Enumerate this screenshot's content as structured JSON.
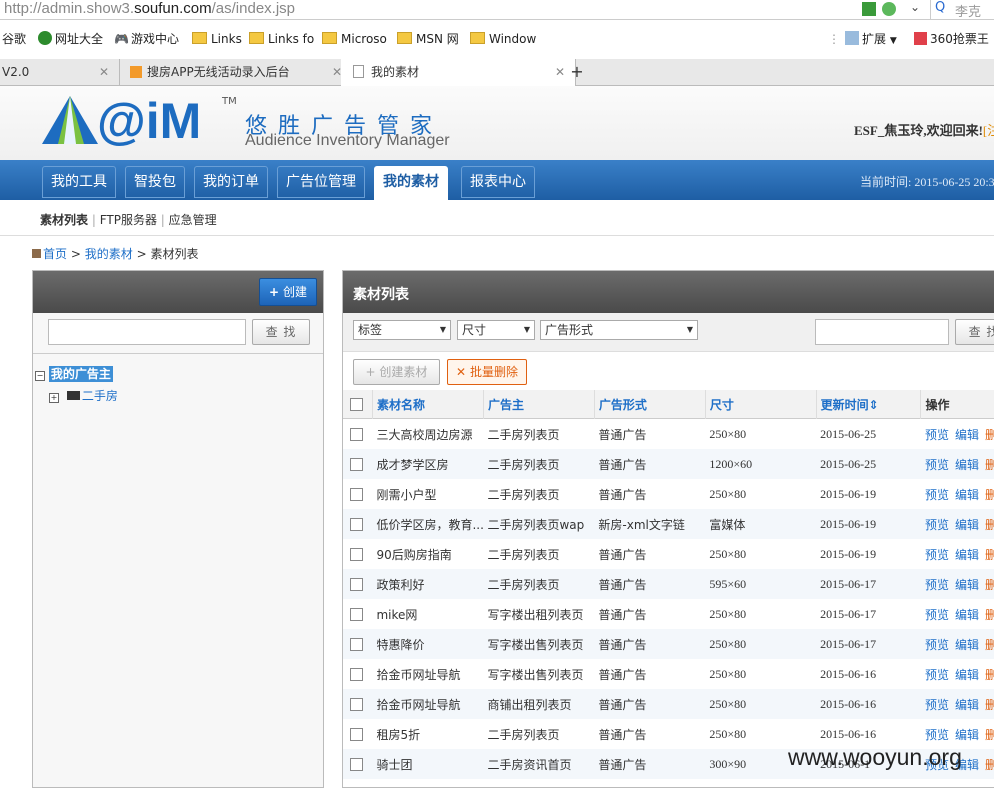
{
  "browser": {
    "url_prefix": "http://admin.show3.",
    "url_domain": "soufun.com",
    "url_suffix": "/as/index.jsp",
    "search_placeholder": "李克",
    "bookmarks": [
      "谷歌",
      "网址大全",
      "游戏中心",
      "Links",
      "Links fo",
      "Microso",
      "MSN 网",
      "Window"
    ],
    "bookmarks_right": [
      "扩展",
      "360抢票王"
    ],
    "tabs": [
      {
        "label": "V2.0"
      },
      {
        "label": "搜房APP无线活动录入后台"
      },
      {
        "label": "我的素材"
      }
    ],
    "new_tab": "+"
  },
  "header": {
    "logo_text": "@iM",
    "logo_tm": "TM",
    "title_cn": "悠 胜 广 告 管 家",
    "title_en": "Audience Inventory Manager",
    "welcome": "ESF_焦玉玲,欢迎回来!",
    "logout_fragment": "注"
  },
  "nav": {
    "items": [
      "我的工具",
      "智投包",
      "我的订单",
      "广告位管理",
      "我的素材",
      "报表中心"
    ],
    "active_index": 4,
    "current_time": "当前时间: 2015-06-25 20:3"
  },
  "subnav": {
    "items": [
      "素材列表",
      "FTP服务器",
      "应急管理"
    ]
  },
  "breadcrumb": {
    "home": "首页",
    "sep": ">",
    "level1": "我的素材",
    "level2": "素材列表"
  },
  "left_panel": {
    "create_label": "创建",
    "search_button": "查 找",
    "tree_root": "我的广告主",
    "tree_child": "二手房"
  },
  "right_panel": {
    "title": "素材列表",
    "filters": [
      "标签",
      "尺寸",
      "广告形式"
    ],
    "search_button": "查 找",
    "create_material": "创建素材",
    "batch_delete": "批量删除",
    "columns": [
      "素材名称",
      "广告主",
      "广告形式",
      "尺寸",
      "更新时间",
      "操作"
    ],
    "sort_icon": "⇕",
    "actions": [
      "预览",
      "编辑",
      "删"
    ],
    "rows": [
      {
        "name": "三大高校周边房源",
        "advertiser": "二手房列表页",
        "format": "普通广告",
        "size": "250×80",
        "updated": "2015-06-25"
      },
      {
        "name": "成才梦学区房",
        "advertiser": "二手房列表页",
        "format": "普通广告",
        "size": "1200×60",
        "updated": "2015-06-25"
      },
      {
        "name": "刚需小户型",
        "advertiser": "二手房列表页",
        "format": "普通广告",
        "size": "250×80",
        "updated": "2015-06-19"
      },
      {
        "name": "低价学区房，教育...",
        "advertiser": "二手房列表页wap",
        "format": "新房-xml文字链",
        "size": "富媒体",
        "updated": "2015-06-19"
      },
      {
        "name": "90后购房指南",
        "advertiser": "二手房列表页",
        "format": "普通广告",
        "size": "250×80",
        "updated": "2015-06-19"
      },
      {
        "name": "政策利好",
        "advertiser": "二手房列表页",
        "format": "普通广告",
        "size": "595×60",
        "updated": "2015-06-17"
      },
      {
        "name": "mike网",
        "advertiser": "写字楼出租列表页",
        "format": "普通广告",
        "size": "250×80",
        "updated": "2015-06-17"
      },
      {
        "name": "特惠降价",
        "advertiser": "写字楼出售列表页",
        "format": "普通广告",
        "size": "250×80",
        "updated": "2015-06-17"
      },
      {
        "name": "拾金币网址导航",
        "advertiser": "写字楼出售列表页",
        "format": "普通广告",
        "size": "250×80",
        "updated": "2015-06-16"
      },
      {
        "name": "拾金币网址导航",
        "advertiser": "商铺出租列表页",
        "format": "普通广告",
        "size": "250×80",
        "updated": "2015-06-16"
      },
      {
        "name": "租房5折",
        "advertiser": "二手房列表页",
        "format": "普通广告",
        "size": "250×80",
        "updated": "2015-06-16"
      },
      {
        "name": "骑士团",
        "advertiser": "二手房资讯首页",
        "format": "普通广告",
        "size": "300×90",
        "updated": "2015-06-1"
      }
    ]
  },
  "watermark": "www.wooyun.org",
  "colors": {
    "nav_blue": "#1e5ea4",
    "link_blue": "#1e6fc8",
    "panel_dark": "#4a4a4a",
    "delete_orange": "#e06010"
  }
}
